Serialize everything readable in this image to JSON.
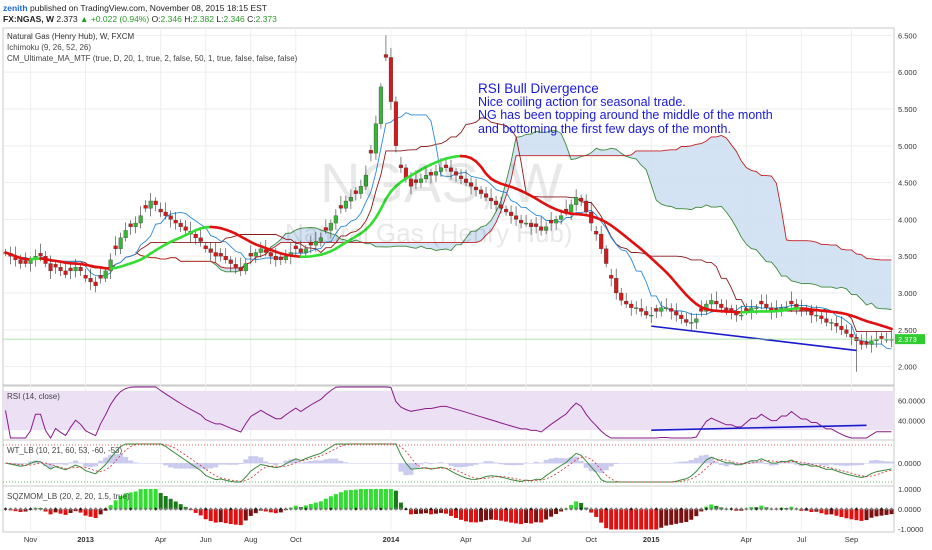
{
  "header": {
    "author": "zenith",
    "published": "published on TradingView.com, November 08, 2015 18:15 EST",
    "symbol": "FX:NGAS, W",
    "last": "2.373",
    "change": "+0.022 (0.94%)",
    "o_label": "O:",
    "o": "2.346",
    "h_label": "H:",
    "h": "2.382",
    "l_label": "L:",
    "l": "2.346",
    "c_label": "C:",
    "c": "2.373",
    "legend": [
      "Natural Gas (Henry Hub), W, FXCM",
      "Ichimoku (9, 26, 52, 26)",
      "CM_Ultimate_MA_MTF (true, D, 20, 1, true, 2, false, 50, 1, true, false, false, false)"
    ]
  },
  "watermark": {
    "symbol": "NGAS, W",
    "name": "Natural Gas (Henry Hub)"
  },
  "annotation": [
    "RSI Bull Divergence",
    "Nice coiling action for seasonal trade.",
    "NG has been topping around the middle of the month",
    "and bottoming the first few days of the month."
  ],
  "panes": {
    "rsi_label": "RSI (14, close)",
    "wt_label": "WT_LB (10, 21, 60, 53, -60, -53)",
    "sqz_label": "SQZMOM_LB (20, 2, 20, 1.5, true)"
  },
  "colors": {
    "up": "#3bb33b",
    "down": "#d21b1b",
    "ma_up": "#33dd33",
    "ma_down": "#e01010",
    "tenkan": "#2a8ad8",
    "kijun": "#8b1a1a",
    "cloud": "#c9dcf0",
    "rsi": "#8a1a8a",
    "rsi_band": "#ece0f4",
    "divergence": "#1a1acc",
    "last_price": "#2ecc2e"
  },
  "chart_data": [
    {
      "type": "candlestick",
      "title": "Natural Gas (Henry Hub), W, FXCM",
      "ylim": [
        1.75,
        6.6
      ],
      "y_ticks": [
        2.0,
        2.5,
        3.0,
        3.5,
        4.0,
        4.5,
        5.0,
        5.5,
        6.0,
        6.5
      ],
      "y_tick_labels": [
        "2.000",
        "2.500",
        "3.000",
        "3.500",
        "4.000",
        "4.500",
        "5.000",
        "5.500",
        "6.000",
        "6.500"
      ],
      "x_ticks": [
        "Nov",
        "2013",
        "Apr",
        "Jun",
        "Aug",
        "Oct",
        "2014",
        "Apr",
        "Jul",
        "Oct",
        "2015",
        "Apr",
        "Jul",
        "Sep"
      ],
      "x_tick_index": [
        5,
        16,
        31,
        40,
        49,
        58,
        77,
        92,
        104,
        117,
        129,
        148,
        159,
        169
      ],
      "bars": 180,
      "close": [
        3.55,
        3.5,
        3.45,
        3.4,
        3.4,
        3.45,
        3.5,
        3.5,
        3.4,
        3.3,
        3.35,
        3.3,
        3.25,
        3.3,
        3.35,
        3.3,
        3.2,
        3.15,
        3.1,
        3.2,
        3.3,
        3.45,
        3.6,
        3.75,
        3.85,
        3.9,
        3.95,
        4.05,
        4.15,
        4.25,
        4.2,
        4.1,
        4.05,
        4.0,
        3.95,
        3.9,
        3.85,
        3.8,
        3.75,
        3.7,
        3.6,
        3.55,
        3.5,
        3.5,
        3.45,
        3.4,
        3.35,
        3.3,
        3.4,
        3.5,
        3.55,
        3.6,
        3.55,
        3.5,
        3.45,
        3.45,
        3.5,
        3.55,
        3.6,
        3.55,
        3.6,
        3.65,
        3.7,
        3.75,
        3.85,
        3.95,
        4.05,
        4.15,
        4.25,
        4.3,
        4.35,
        4.45,
        4.6,
        4.9,
        5.3,
        5.8,
        6.2,
        5.6,
        5.0,
        4.7,
        4.55,
        4.45,
        4.5,
        4.55,
        4.6,
        4.6,
        4.65,
        4.7,
        4.7,
        4.65,
        4.6,
        4.55,
        4.5,
        4.45,
        4.4,
        4.35,
        4.3,
        4.25,
        4.2,
        4.15,
        4.1,
        4.05,
        4.0,
        3.95,
        3.95,
        3.9,
        3.9,
        3.85,
        3.9,
        3.95,
        4.0,
        4.05,
        4.1,
        4.2,
        4.3,
        4.25,
        4.1,
        3.95,
        3.8,
        3.6,
        3.4,
        3.2,
        3.0,
        2.9,
        2.85,
        2.8,
        2.8,
        2.75,
        2.7,
        2.7,
        2.75,
        2.8,
        2.8,
        2.75,
        2.7,
        2.65,
        2.6,
        2.6,
        2.65,
        2.75,
        2.85,
        2.9,
        2.85,
        2.8,
        2.75,
        2.75,
        2.7,
        2.7,
        2.75,
        2.8,
        2.8,
        2.85,
        2.8,
        2.75,
        2.75,
        2.8,
        2.8,
        2.85,
        2.8,
        2.75,
        2.75,
        2.7,
        2.7,
        2.65,
        2.6,
        2.6,
        2.55,
        2.5,
        2.45,
        2.4,
        2.35,
        2.3,
        2.3,
        2.35,
        2.373,
        2.373,
        2.373,
        2.373
      ],
      "divergence_line": {
        "from": {
          "bar": 129,
          "price": 2.55
        },
        "to": {
          "bar": 170,
          "price": 2.22
        }
      },
      "last_price": 2.373
    },
    {
      "type": "line",
      "title": "RSI (14, close)",
      "ylim": [
        20,
        75
      ],
      "y_ticks": [
        40,
        60
      ],
      "y_tick_labels": [
        "40.0000",
        "60.0000"
      ],
      "band": [
        30,
        70
      ],
      "divergence_line": {
        "from": {
          "bar": 129,
          "value": 30
        },
        "to": {
          "bar": 172,
          "value": 35
        }
      }
    },
    {
      "type": "line",
      "title": "WT_LB (10, 21, 60, 53, -60, -53)",
      "y_ticks": [
        0
      ],
      "y_tick_labels": [
        "0.0000"
      ]
    },
    {
      "type": "bar",
      "title": "SQZMOM_LB (20, 2, 20, 1.5, true)",
      "y_ticks": [
        1,
        0,
        -1
      ],
      "y_tick_labels": [
        "1.0000",
        "0.0000",
        "-1.0000"
      ]
    }
  ]
}
